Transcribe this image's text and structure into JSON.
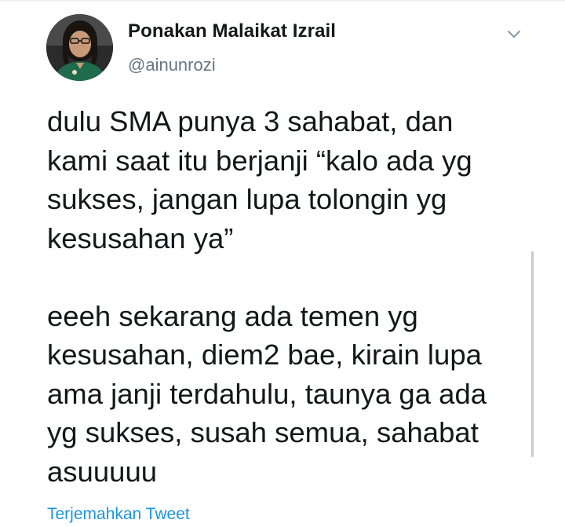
{
  "user": {
    "display_name": "Ponakan Malaikat Izrail",
    "handle": "@ainunrozi"
  },
  "tweet": {
    "text": "dulu SMA punya 3 sahabat, dan\nkami saat itu berjanji “kalo ada yg\nsukses, jangan lupa tolongin yg\nkesusahan ya”\n\neeeh sekarang ada temen yg\nkesusahan, diem2 bae, kirain lupa\nama janji terdahulu, taunya ga ada\nyg sukses, susah semua, sahabat\nasuuuuu"
  },
  "actions": {
    "translate_label": "Terjemahkan Tweet"
  },
  "icons": {
    "menu": "chevron-down-icon"
  },
  "colors": {
    "text": "#14171a",
    "secondary": "#657786",
    "link": "#1b95e0"
  }
}
